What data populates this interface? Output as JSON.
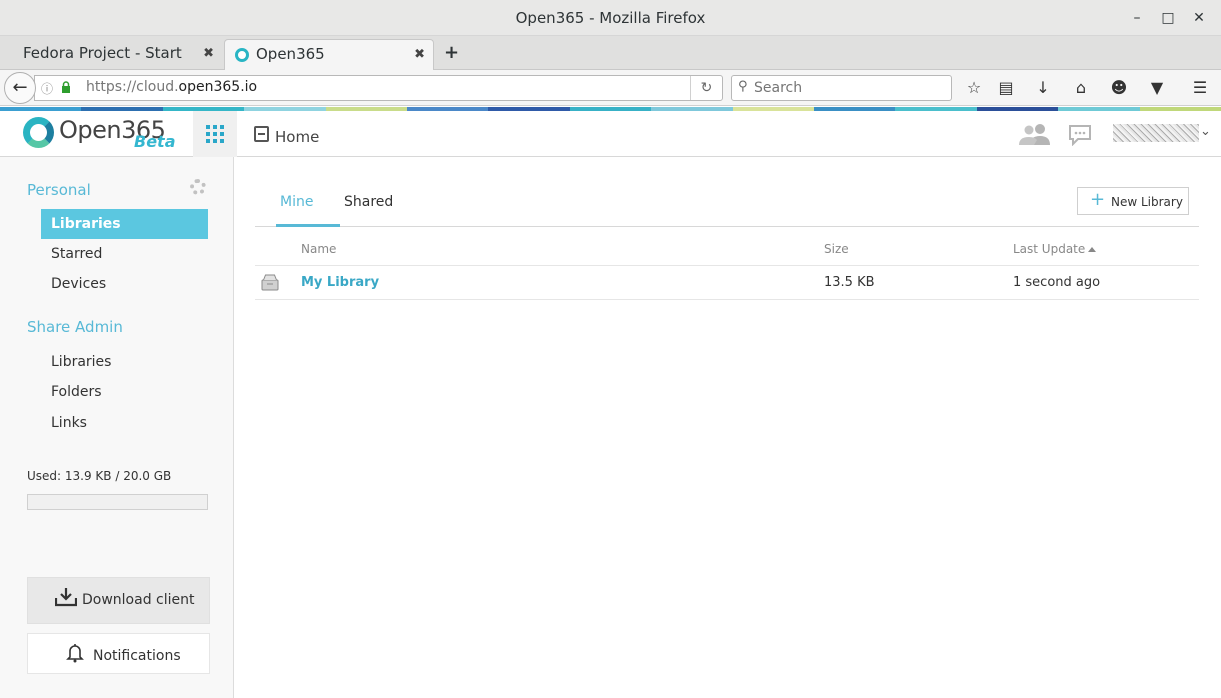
{
  "window": {
    "title": "Open365 - Mozilla Firefox"
  },
  "browser": {
    "tabs": [
      {
        "label": "Fedora Project - Start Page"
      },
      {
        "label": "Open365"
      }
    ],
    "url_prefix": "https://cloud.",
    "url_domain": "open365.io",
    "search_placeholder": "Search"
  },
  "header": {
    "logo_text": "Open365",
    "logo_badge": "Beta",
    "breadcrumb_home": "Home"
  },
  "sidebar": {
    "personal_title": "Personal",
    "personal_items": [
      {
        "label": "Libraries",
        "active": true
      },
      {
        "label": "Starred"
      },
      {
        "label": "Devices"
      }
    ],
    "share_admin_title": "Share Admin",
    "share_admin_items": [
      {
        "label": "Libraries"
      },
      {
        "label": "Folders"
      },
      {
        "label": "Links"
      }
    ],
    "usage_text": "Used: 13.9 KB / 20.0 GB",
    "usage_fraction": 0.0,
    "download_label": "Download client",
    "notifications_label": "Notifications"
  },
  "main": {
    "tabs": [
      {
        "label": "Mine",
        "active": true
      },
      {
        "label": "Shared"
      }
    ],
    "new_library_label": "New Library",
    "columns": {
      "name": "Name",
      "size": "Size",
      "last_update": "Last Update"
    },
    "rows": [
      {
        "name": "My Library",
        "size": "13.5 KB",
        "last_update": "1 second ago"
      }
    ]
  },
  "colors": {
    "accent": "#58b9d6",
    "active_nav": "#5bc7e0",
    "strip": [
      "#3b9fd1",
      "#2d6fb0",
      "#35b6c7",
      "#8fd3e0",
      "#c9dc8a",
      "#4b88c8",
      "#2f5aa8",
      "#38b1c6",
      "#7fc8db",
      "#d9e39a",
      "#3a8fc4",
      "#4bbfcc",
      "#2b4f99",
      "#6fcad6",
      "#c0d87a"
    ]
  }
}
